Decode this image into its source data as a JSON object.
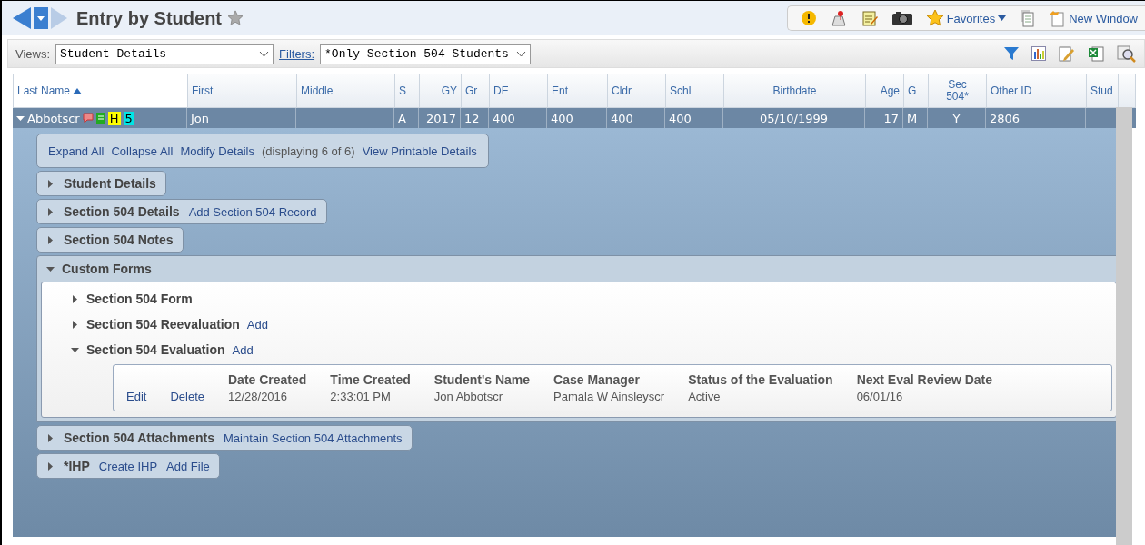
{
  "header": {
    "title": "Entry by Student",
    "toolbar": [
      {
        "kind": "alert"
      },
      {
        "kind": "map"
      },
      {
        "kind": "notes"
      },
      {
        "kind": "camera"
      },
      {
        "kind": "favorites",
        "label": "Favorites"
      },
      {
        "kind": "copy"
      },
      {
        "kind": "window",
        "label": "New Window"
      }
    ]
  },
  "views": {
    "label": "Views:",
    "value": "Student Details",
    "filters_label": "Filters:",
    "filter_value": "*Only Section 504 Students"
  },
  "table": {
    "columns": [
      {
        "label": "Last Name",
        "sorted": true
      },
      {
        "label": "First",
        "sorted": false
      },
      {
        "label": "Middle",
        "sorted": false
      },
      {
        "label": "S",
        "sorted": false
      },
      {
        "label": "GY",
        "sorted": false
      },
      {
        "label": "Gr",
        "sorted": false
      },
      {
        "label": "DE",
        "sorted": false
      },
      {
        "label": "Ent",
        "sorted": false
      },
      {
        "label": "Cldr",
        "sorted": false
      },
      {
        "label": "Schl",
        "sorted": false
      },
      {
        "label": "Birthdate",
        "sorted": false
      },
      {
        "label": "Age",
        "sorted": false
      },
      {
        "label": "G",
        "sorted": false
      },
      {
        "label": "Sec 504*",
        "sorted": false
      },
      {
        "label": "Other ID",
        "sorted": false
      },
      {
        "label": "Stud",
        "sorted": false
      }
    ],
    "rows": [
      {
        "expanded": true,
        "badges": [
          {
            "text": "H",
            "color": "#ffff00"
          },
          {
            "text": "5",
            "color": "#00e5e5"
          }
        ],
        "cells": [
          "Abbotscr",
          "Jon",
          "",
          "A",
          "2017",
          "12",
          "400",
          "400",
          "400",
          "400",
          "05/10/1999",
          "17",
          "M",
          "Y",
          "2806",
          ""
        ]
      }
    ]
  },
  "detail": {
    "actions": [
      {
        "kind": "link",
        "text": "Expand All"
      },
      {
        "kind": "link",
        "text": "Collapse All"
      },
      {
        "kind": "link",
        "text": "Modify Details"
      },
      {
        "kind": "note",
        "text": "(displaying 6 of 6)"
      },
      {
        "kind": "link",
        "text": "View Printable Details"
      }
    ],
    "sections": [
      {
        "title": "Student Details",
        "expanded": false
      },
      {
        "title": "Section 504 Details",
        "expanded": false,
        "links": [
          "Add Section 504 Record"
        ]
      },
      {
        "title": "Section 504 Notes",
        "expanded": false
      },
      {
        "title": "Custom Forms",
        "expanded": true,
        "forms": [
          {
            "title": "Section 504 Form",
            "expanded": false
          },
          {
            "title": "Section 504 Reevaluation",
            "expanded": false,
            "links": [
              "Add"
            ]
          },
          {
            "title": "Section 504 Evaluation",
            "expanded": true,
            "links": [
              "Add"
            ],
            "record": {
              "actions": [
                "Edit",
                "Delete"
              ],
              "fields": [
                {
                  "label": "Date Created",
                  "value": "12/28/2016"
                },
                {
                  "label": "Time Created",
                  "value": "2:33:01 PM"
                },
                {
                  "label": "Student's Name",
                  "value": "Jon Abbotscr"
                },
                {
                  "label": "Case Manager",
                  "value": "Pamala W Ainsleyscr"
                },
                {
                  "label": "Status of the Evaluation",
                  "value": "Active"
                },
                {
                  "label": "Next Eval Review Date",
                  "value": "06/01/16"
                }
              ]
            }
          }
        ]
      },
      {
        "title": "Section 504 Attachments",
        "expanded": false,
        "links": [
          "Maintain Section 504 Attachments"
        ]
      },
      {
        "title": "*IHP",
        "expanded": false,
        "links": [
          "Create IHP",
          "Add File"
        ]
      }
    ]
  }
}
